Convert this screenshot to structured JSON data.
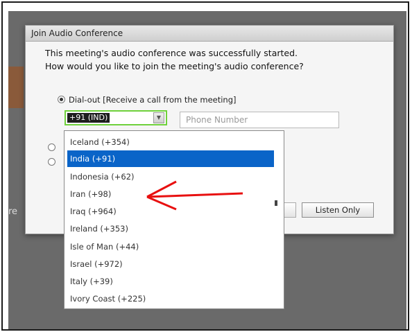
{
  "dialog": {
    "title": "Join Audio Conference",
    "message_line1": "This meeting's audio conference was successfully started.",
    "message_line2": "How would you like to join the meeting's audio conference?",
    "dialout_label": "Dial-out [Receive a call from the meeting]",
    "selected_country": "+91 (IND)",
    "phone_placeholder": "Phone Number",
    "listen_only_label": "Listen Only"
  },
  "background": {
    "left_text": "re"
  },
  "country_list": [
    "Iceland (+354)",
    "India (+91)",
    "Indonesia (+62)",
    "Iran (+98)",
    "Iraq (+964)",
    "Ireland (+353)",
    "Isle of Man (+44)",
    "Israel (+972)",
    "Italy (+39)",
    "Ivory Coast (+225)"
  ],
  "selected_index": 1,
  "colors": {
    "selection": "#0a64c8",
    "focus_border": "#6fd13b",
    "arrow": "#e81010"
  },
  "icons": {
    "dropdown": "chevron-down-icon",
    "annotation": "red-arrow-icon"
  }
}
